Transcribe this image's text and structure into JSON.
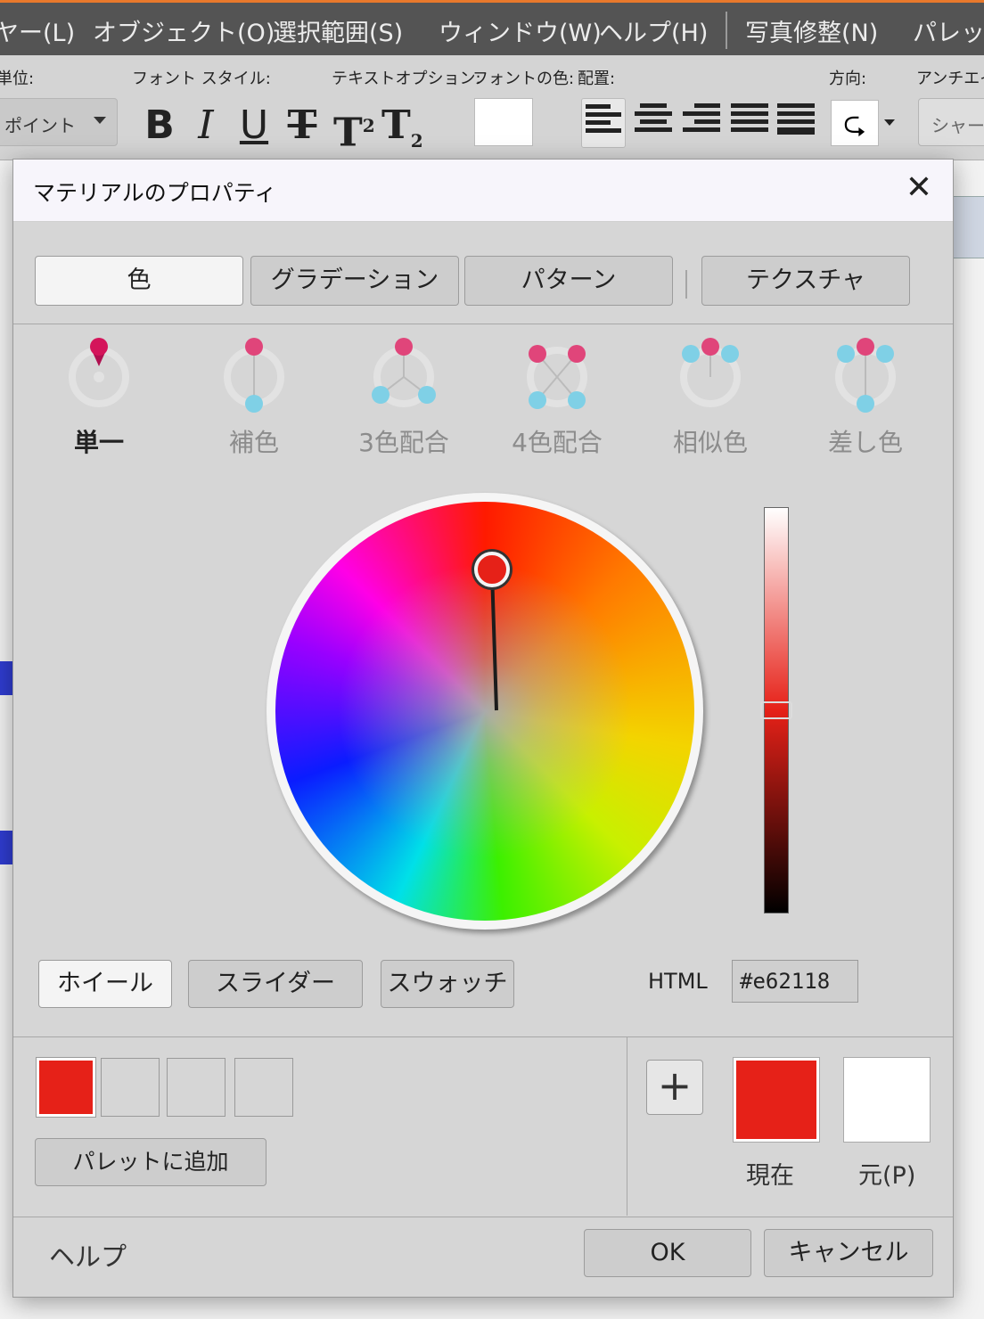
{
  "menubar": {
    "items": [
      "ヤー(L)",
      "オブジェクト(O)",
      "選択範囲(S)",
      "ウィンドウ(W)",
      "ヘルプ(H)",
      "写真修整(N)",
      "パレット"
    ]
  },
  "toolbar": {
    "unit_label": "単位:",
    "font_style_label": "フォント スタイル:",
    "text_options_label": "テキストオプション:",
    "font_color_label": "フォントの色:",
    "alignment_label": "配置:",
    "direction_label": "方向:",
    "antialias_label": "アンチエイ",
    "unit_value": "ポイント",
    "style_bold": "B",
    "style_italic": "I",
    "style_underline": "U",
    "style_strike": "T",
    "style_super": "T",
    "style_super_mark": "2",
    "style_sub": "T",
    "style_sub_mark": "2",
    "direction_glyph": "⮎",
    "sharpness_value": "シャープ",
    "font_color": "#ffffff"
  },
  "dialog": {
    "title": "マテリアルのプロパティ",
    "close_glyph": "✕",
    "tabs": [
      "色",
      "グラデーション",
      "パターン",
      "テクスチャ"
    ],
    "active_tab": 0,
    "harmony_modes": [
      "単一",
      "補色",
      "3色配合",
      "4色配合",
      "相似色",
      "差し色"
    ],
    "active_mode": 0,
    "picker_modes": [
      "ホイール",
      "スライダー",
      "スウォッチ"
    ],
    "active_picker": 0,
    "html_label": "HTML",
    "html_value": "#e62118",
    "palette_button": "パレットに追加",
    "add_glyph": "+",
    "current_label": "現在",
    "original_label": "元(P)",
    "current_color": "#e62118",
    "original_color": "#ffffff",
    "help": "ヘルプ",
    "ok": "OK",
    "cancel": "キャンセル"
  },
  "colors": {
    "accent_pink": "#e0457a",
    "accent_cyan": "#7fd0e6",
    "menubar_accent": "#e8792c"
  }
}
